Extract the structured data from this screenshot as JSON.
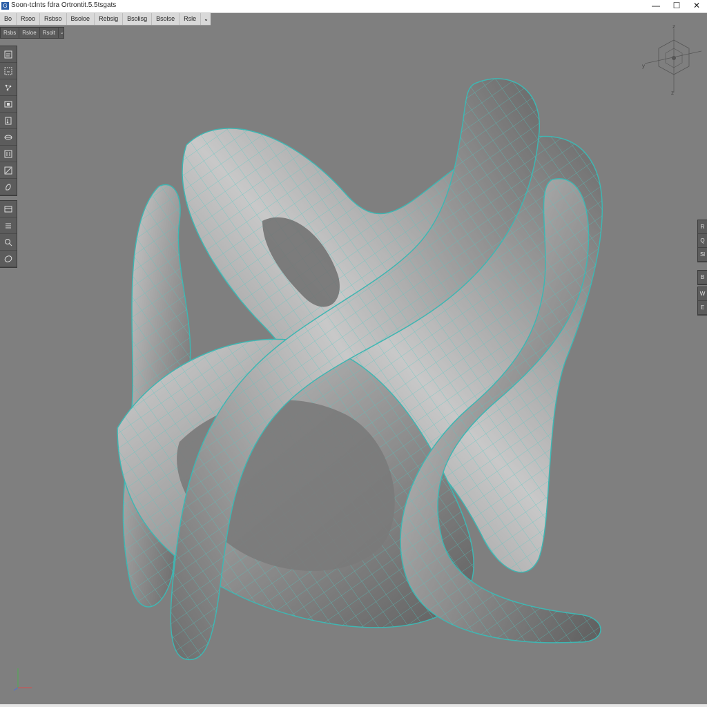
{
  "window": {
    "title": "Soon-tclnts fdra Ortrontit.5.5tsgats",
    "app_icon_glyph": "G",
    "minimize_glyph": "—",
    "maximize_glyph": "☐",
    "close_glyph": "✕"
  },
  "menubar": {
    "items": [
      "Bo",
      "Rsoo",
      "Rsbso",
      "Bsoloe",
      "Rebsig",
      "Bsolisg",
      "Bsolse",
      "Rsle"
    ],
    "dropdown_glyph": "⌄"
  },
  "toolbar2": {
    "items": [
      "Rsbs",
      "Rsloe",
      "Rsolt"
    ],
    "dropdown_glyph": "⌄"
  },
  "left_tools": {
    "group1": [
      "select-tool-icon",
      "box-select-icon",
      "vertex-move-icon",
      "face-select-icon",
      "extrude-icon",
      "edge-loop-icon",
      "bridge-icon",
      "knife-icon",
      "sculpt-icon"
    ],
    "group2": [
      "grid-icon",
      "list-icon",
      "zoom-icon",
      "orbit-icon"
    ]
  },
  "gizmo": {
    "top": "z",
    "left": "y",
    "bottom": "z"
  },
  "right_panel": {
    "group1": [
      "R",
      "Q",
      "Sl"
    ],
    "group2": [
      "B"
    ],
    "group3": [
      "W",
      "E"
    ]
  },
  "colors": {
    "viewport_bg": "#7f7f7f",
    "mesh_surface": "#9c9c9c",
    "wireframe": "#48c8c4",
    "panel": "#5c5c5c"
  }
}
